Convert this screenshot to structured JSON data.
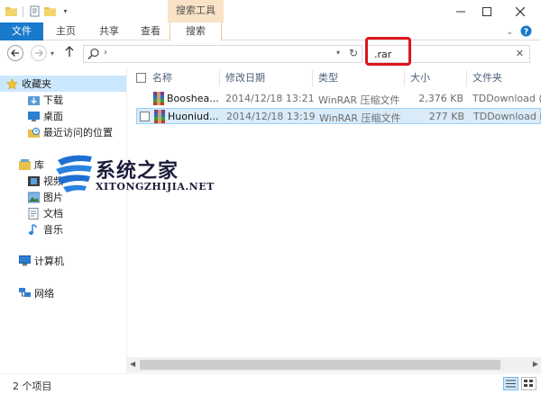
{
  "titlebar": {
    "context_group": "搜索工具"
  },
  "ribbon": {
    "tabs": [
      "文件",
      "主页",
      "共享",
      "查看",
      "搜索"
    ]
  },
  "address": {
    "search_value": ".rar"
  },
  "nav": {
    "favorites": "收藏夹",
    "downloads": "下载",
    "desktop": "桌面",
    "recent": "最近访问的位置",
    "library": "库",
    "videos": "视频",
    "pictures": "图片",
    "documents": "文档",
    "music": "音乐",
    "computer": "计算机",
    "network": "网络"
  },
  "columns": {
    "name": "名称",
    "modified": "修改日期",
    "type": "类型",
    "size": "大小",
    "folder": "文件夹"
  },
  "files": [
    {
      "name": "Booshea...",
      "modified": "2014/12/18 13:21",
      "type": "WinRAR 压缩文件",
      "size": "2,376 KB",
      "folder": "TDDownload (("
    },
    {
      "name": "Huoniud...",
      "modified": "2014/12/18 13:19",
      "type": "WinRAR 压缩文件",
      "size": "277 KB",
      "folder": "TDDownload (("
    }
  ],
  "status": {
    "count": "2 个项目"
  },
  "watermark": {
    "cn": "系统之家",
    "en": "XITONGZHIJIA.NET"
  },
  "colors": {
    "file_tab": "#1979ca",
    "context_tab": "#f9e2c5",
    "selection": "#cce8ff",
    "highlight_box": "#e0141e"
  }
}
